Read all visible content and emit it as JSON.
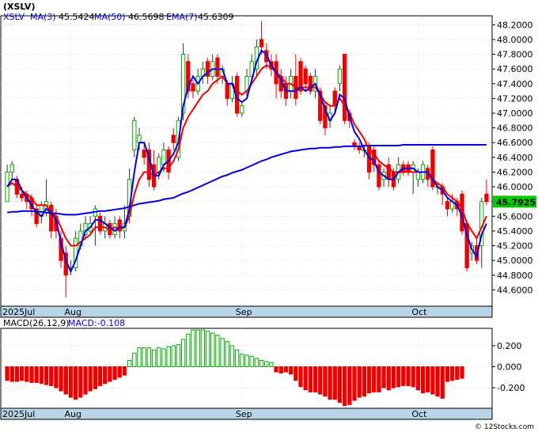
{
  "chart_data": [
    {
      "type": "candlestick",
      "title": "(XSLV)",
      "legend": [
        {
          "label": "XSLV",
          "value": "",
          "color": "#0000cc"
        },
        {
          "label": "MA(3)",
          "value": "45.5424",
          "color": "#0000cc"
        },
        {
          "label": "MA(50)",
          "value": "46.5698",
          "color": "#0000cc"
        },
        {
          "label": "EMA(7)",
          "value": "45.6309",
          "color": "#0000cc"
        }
      ],
      "last_price": "45.7925",
      "ylim": [
        44.4,
        48.3
      ],
      "yticks": [
        "48.2000",
        "48.0000",
        "47.8000",
        "47.6000",
        "47.4000",
        "47.2000",
        "47.0000",
        "46.8000",
        "46.6000",
        "46.4000",
        "46.2000",
        "46.0000",
        "45.8000",
        "45.6000",
        "45.4000",
        "45.2000",
        "45.0000",
        "44.8000",
        "44.6000"
      ],
      "xticks": [
        {
          "label": "2025Jul",
          "index": 0
        },
        {
          "label": "Aug",
          "index": 13
        },
        {
          "label": "Sep",
          "index": 48
        },
        {
          "label": "Oct",
          "index": 84
        }
      ],
      "candles": [
        [
          45.8,
          46.2,
          45.8,
          46.3
        ],
        [
          46.2,
          46.3,
          46.1,
          46.35
        ],
        [
          46.1,
          45.9,
          45.85,
          46.15
        ],
        [
          45.9,
          45.85,
          45.8,
          46.0
        ],
        [
          45.9,
          45.8,
          45.7,
          45.95
        ],
        [
          45.85,
          45.7,
          45.6,
          45.9
        ],
        [
          45.7,
          45.5,
          45.45,
          45.75
        ],
        [
          45.6,
          45.75,
          45.5,
          45.8
        ],
        [
          45.65,
          45.8,
          45.6,
          46.1
        ],
        [
          45.75,
          45.4,
          45.3,
          45.8
        ],
        [
          45.6,
          45.4,
          45.3,
          45.7
        ],
        [
          45.3,
          45.0,
          44.9,
          45.4
        ],
        [
          45.1,
          44.8,
          44.5,
          45.2
        ],
        [
          44.9,
          44.9,
          44.8,
          45.0
        ],
        [
          44.9,
          45.3,
          44.85,
          45.4
        ],
        [
          45.2,
          45.4,
          45.15,
          45.5
        ],
        [
          45.35,
          45.5,
          45.3,
          45.6
        ],
        [
          45.4,
          45.5,
          45.35,
          45.6
        ],
        [
          45.6,
          45.7,
          45.2,
          45.75
        ],
        [
          45.6,
          45.4,
          45.35,
          45.65
        ],
        [
          45.4,
          45.5,
          45.3,
          45.6
        ],
        [
          45.5,
          45.35,
          45.3,
          45.55
        ],
        [
          45.35,
          45.5,
          45.3,
          45.6
        ],
        [
          45.55,
          45.4,
          45.3,
          45.6
        ],
        [
          45.4,
          45.5,
          45.3,
          45.75
        ],
        [
          45.6,
          46.1,
          45.5,
          46.25
        ],
        [
          46.5,
          46.9,
          46.4,
          46.95
        ],
        [
          46.6,
          46.7,
          46.5,
          46.8
        ],
        [
          46.5,
          46.4,
          46.3,
          46.6
        ],
        [
          46.5,
          46.1,
          46.0,
          46.6
        ],
        [
          46.3,
          46.0,
          45.95,
          46.5
        ],
        [
          46.2,
          46.4,
          46.1,
          46.45
        ],
        [
          46.3,
          46.5,
          46.2,
          46.6
        ],
        [
          46.5,
          46.2,
          46.1,
          46.55
        ],
        [
          46.7,
          46.6,
          46.5,
          46.8
        ],
        [
          46.4,
          46.9,
          46.35,
          46.95
        ],
        [
          47.0,
          47.8,
          46.9,
          47.95
        ],
        [
          47.7,
          47.3,
          47.2,
          47.8
        ],
        [
          47.4,
          47.3,
          47.2,
          47.45
        ],
        [
          47.3,
          47.5,
          47.25,
          47.6
        ],
        [
          47.5,
          47.6,
          47.4,
          47.7
        ],
        [
          47.7,
          47.5,
          47.4,
          47.75
        ],
        [
          47.5,
          47.7,
          47.45,
          47.8
        ],
        [
          47.75,
          47.5,
          47.4,
          47.8
        ],
        [
          47.5,
          47.6,
          47.4,
          47.65
        ],
        [
          47.4,
          47.2,
          47.1,
          47.45
        ],
        [
          47.2,
          47.4,
          47.15,
          47.5
        ],
        [
          47.5,
          47.0,
          46.95,
          47.55
        ],
        [
          47.0,
          47.1,
          46.95,
          47.15
        ],
        [
          47.3,
          47.5,
          47.2,
          47.6
        ],
        [
          47.5,
          47.7,
          47.45,
          47.8
        ],
        [
          47.6,
          47.9,
          47.5,
          48.0
        ],
        [
          48.0,
          47.9,
          47.8,
          48.25
        ],
        [
          47.85,
          47.7,
          47.6,
          47.95
        ],
        [
          47.7,
          47.6,
          47.5,
          47.8
        ],
        [
          47.7,
          47.4,
          47.2,
          47.8
        ],
        [
          47.5,
          47.3,
          47.2,
          47.6
        ],
        [
          47.4,
          47.2,
          47.1,
          47.5
        ],
        [
          47.3,
          47.5,
          47.2,
          47.6
        ],
        [
          47.5,
          47.2,
          47.1,
          47.8
        ],
        [
          47.7,
          47.3,
          47.25,
          47.75
        ],
        [
          47.6,
          47.4,
          47.3,
          47.65
        ],
        [
          47.5,
          47.3,
          47.25,
          47.55
        ],
        [
          47.3,
          47.5,
          47.2,
          47.6
        ],
        [
          47.3,
          46.9,
          46.85,
          47.35
        ],
        [
          47.1,
          46.8,
          46.7,
          47.15
        ],
        [
          46.9,
          47.0,
          46.8,
          47.1
        ],
        [
          47.3,
          47.1,
          47.0,
          47.35
        ],
        [
          47.4,
          47.6,
          47.3,
          47.65
        ],
        [
          47.8,
          46.9,
          46.85,
          47.8
        ],
        [
          47.0,
          46.9,
          46.8,
          47.05
        ],
        [
          46.6,
          46.55,
          46.5,
          46.65
        ],
        [
          46.55,
          46.5,
          46.45,
          46.6
        ],
        [
          46.5,
          46.5,
          46.4,
          46.55
        ],
        [
          46.55,
          46.2,
          46.1,
          46.6
        ],
        [
          46.5,
          46.3,
          46.2,
          46.55
        ],
        [
          46.3,
          46.0,
          45.95,
          46.35
        ],
        [
          46.1,
          46.2,
          46.0,
          46.25
        ],
        [
          46.3,
          46.1,
          46.0,
          46.4
        ],
        [
          46.2,
          46.0,
          45.95,
          46.25
        ],
        [
          46.1,
          46.3,
          46.05,
          46.4
        ],
        [
          46.3,
          46.2,
          46.15,
          46.35
        ],
        [
          46.3,
          46.2,
          46.15,
          46.35
        ],
        [
          46.2,
          46.3,
          45.9,
          46.35
        ],
        [
          46.1,
          46.2,
          46.0,
          46.25
        ],
        [
          46.1,
          46.3,
          46.05,
          46.35
        ],
        [
          46.25,
          46.1,
          46.0,
          46.3
        ],
        [
          46.5,
          46.0,
          45.95,
          46.55
        ],
        [
          46.0,
          46.0,
          45.9,
          46.05
        ],
        [
          46.0,
          45.9,
          45.75,
          46.05
        ],
        [
          45.8,
          45.7,
          45.6,
          45.85
        ],
        [
          45.7,
          45.8,
          45.65,
          45.9
        ],
        [
          45.8,
          45.7,
          45.6,
          45.85
        ],
        [
          45.9,
          45.4,
          45.35,
          45.95
        ],
        [
          45.5,
          44.9,
          44.85,
          45.55
        ],
        [
          45.1,
          45.2,
          45.0,
          45.25
        ],
        [
          45.2,
          45.0,
          44.95,
          45.3
        ],
        [
          45.2,
          45.8,
          44.9,
          45.85
        ],
        [
          45.9,
          45.8,
          45.75,
          46.1
        ]
      ],
      "ma3": [
        46.0,
        46.1,
        46.1,
        45.95,
        45.85,
        45.75,
        45.65,
        45.6,
        45.7,
        45.65,
        45.55,
        45.25,
        45.0,
        44.85,
        45.0,
        45.2,
        45.4,
        45.45,
        45.55,
        45.55,
        45.5,
        45.45,
        45.4,
        45.45,
        45.45,
        45.7,
        46.2,
        46.6,
        46.6,
        46.4,
        46.15,
        46.15,
        46.3,
        46.35,
        46.45,
        46.6,
        47.1,
        47.35,
        47.5,
        47.4,
        47.5,
        47.55,
        47.6,
        47.6,
        47.6,
        47.4,
        47.4,
        47.2,
        47.15,
        47.2,
        47.45,
        47.7,
        47.85,
        47.8,
        47.65,
        47.55,
        47.45,
        47.3,
        47.3,
        47.3,
        47.35,
        47.3,
        47.35,
        47.4,
        47.25,
        47.05,
        46.9,
        47.0,
        47.25,
        47.2,
        46.95,
        46.75,
        46.65,
        46.5,
        46.4,
        46.35,
        46.2,
        46.15,
        46.1,
        46.1,
        46.2,
        46.25,
        46.25,
        46.25,
        46.2,
        46.2,
        46.2,
        46.1,
        46.0,
        45.95,
        45.85,
        45.8,
        45.75,
        45.6,
        45.35,
        45.15,
        45.05,
        45.35,
        45.5
      ],
      "ma50": [
        45.65,
        45.66,
        45.66,
        45.67,
        45.67,
        45.67,
        45.66,
        45.66,
        45.65,
        45.64,
        45.64,
        45.63,
        45.62,
        45.62,
        45.62,
        45.63,
        45.64,
        45.65,
        45.66,
        45.67,
        45.67,
        45.68,
        45.69,
        45.7,
        45.71,
        45.73,
        45.75,
        45.77,
        45.78,
        45.79,
        45.8,
        45.81,
        45.83,
        45.84,
        45.85,
        45.88,
        45.91,
        45.93,
        45.96,
        45.99,
        46.02,
        46.05,
        46.08,
        46.11,
        46.14,
        46.16,
        46.19,
        46.21,
        46.23,
        46.26,
        46.29,
        46.32,
        46.35,
        46.37,
        46.4,
        46.42,
        46.44,
        46.46,
        46.48,
        46.49,
        46.5,
        46.51,
        46.52,
        46.52,
        46.53,
        46.53,
        46.53,
        46.54,
        46.54,
        46.55,
        46.55,
        46.55,
        46.55,
        46.56,
        46.56,
        46.56,
        46.56,
        46.56,
        46.56,
        46.56,
        46.56,
        46.57,
        46.57,
        46.57,
        46.57,
        46.57,
        46.57,
        46.57,
        46.57,
        46.57,
        46.57,
        46.57,
        46.57,
        46.57,
        46.57,
        46.57,
        46.57,
        46.57,
        46.57
      ],
      "ema7": [
        46.0,
        46.05,
        46.0,
        45.95,
        45.9,
        45.85,
        45.75,
        45.75,
        45.75,
        45.65,
        45.6,
        45.45,
        45.3,
        45.2,
        45.2,
        45.25,
        45.3,
        45.35,
        45.45,
        45.45,
        45.45,
        45.42,
        45.45,
        45.43,
        45.45,
        45.6,
        45.9,
        46.1,
        46.2,
        46.2,
        46.15,
        46.2,
        46.25,
        46.25,
        46.35,
        46.5,
        46.8,
        46.95,
        47.05,
        47.15,
        47.25,
        47.3,
        47.4,
        47.45,
        47.5,
        47.4,
        47.4,
        47.3,
        47.25,
        47.3,
        47.4,
        47.5,
        47.6,
        47.65,
        47.62,
        47.55,
        47.5,
        47.4,
        47.4,
        47.35,
        47.35,
        47.35,
        47.35,
        47.35,
        47.25,
        47.15,
        47.1,
        47.1,
        47.2,
        47.1,
        47.0,
        46.85,
        46.75,
        46.65,
        46.5,
        46.45,
        46.35,
        46.3,
        46.25,
        46.2,
        46.2,
        46.2,
        46.2,
        46.2,
        46.2,
        46.2,
        46.2,
        46.1,
        46.05,
        46.0,
        45.9,
        45.85,
        45.8,
        45.7,
        45.5,
        45.4,
        45.3,
        45.45,
        45.6
      ]
    },
    {
      "type": "bar",
      "title": "MACD(26,12,9)",
      "value_label": "MACD:-0.108",
      "ylim": [
        -0.38,
        0.35
      ],
      "yticks": [
        "0.200",
        "0.000",
        "-0.200"
      ],
      "xticks": [
        {
          "label": "2025Jul",
          "index": 0
        },
        {
          "label": "Aug",
          "index": 13
        },
        {
          "label": "Sep",
          "index": 48
        },
        {
          "label": "Oct",
          "index": 84
        }
      ],
      "values": [
        -0.13,
        -0.14,
        -0.14,
        -0.13,
        -0.14,
        -0.15,
        -0.15,
        -0.16,
        -0.17,
        -0.18,
        -0.2,
        -0.23,
        -0.26,
        -0.29,
        -0.31,
        -0.29,
        -0.26,
        -0.23,
        -0.21,
        -0.18,
        -0.16,
        -0.14,
        -0.12,
        -0.1,
        -0.08,
        0.06,
        0.13,
        0.18,
        0.18,
        0.18,
        0.16,
        0.18,
        0.17,
        0.19,
        0.2,
        0.21,
        0.26,
        0.31,
        0.35,
        0.35,
        0.35,
        0.34,
        0.32,
        0.3,
        0.27,
        0.24,
        0.2,
        0.16,
        0.12,
        0.11,
        0.1,
        0.08,
        0.06,
        0.05,
        0.04,
        -0.05,
        -0.06,
        -0.05,
        -0.07,
        -0.13,
        -0.19,
        -0.22,
        -0.24,
        -0.24,
        -0.26,
        -0.28,
        -0.31,
        -0.31,
        -0.34,
        -0.37,
        -0.36,
        -0.32,
        -0.29,
        -0.28,
        -0.25,
        -0.24,
        -0.24,
        -0.2,
        -0.22,
        -0.2,
        -0.19,
        -0.18,
        -0.18,
        -0.19,
        -0.22,
        -0.25,
        -0.24,
        -0.26,
        -0.28,
        -0.3,
        -0.14,
        -0.13,
        -0.12,
        -0.11
      ]
    }
  ],
  "watermark": "© 12Stocks.com",
  "colors": {
    "up": "#00aa00",
    "down": "#ee0000",
    "ma": "#0000dd",
    "ema": "#ee0000",
    "axis_band": "#b8d4e6",
    "price_box": "#00cc00"
  }
}
